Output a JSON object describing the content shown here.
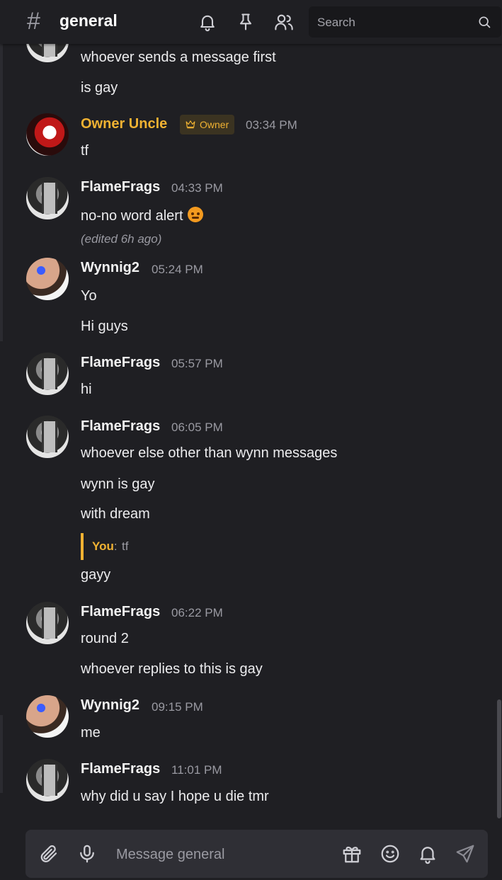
{
  "header": {
    "channel_symbol": "#",
    "channel_name": "general",
    "icons": [
      "bell-icon",
      "pin-icon",
      "members-icon",
      "search-icon"
    ],
    "search_placeholder": "Search"
  },
  "messages": [
    {
      "lines": [
        "whoever sends a message first",
        "is gay"
      ]
    },
    {
      "author": "Owner Uncle",
      "badge": "Owner",
      "time": "03:34 PM",
      "lines": [
        "tf"
      ]
    },
    {
      "author": "FlameFrags",
      "time": "04:33 PM",
      "lines": [
        "no-no word alert"
      ],
      "emoji": "angry-face-emoji",
      "edited": "(edited 6h ago)"
    },
    {
      "author": "Wynnig2",
      "time": "05:24 PM",
      "lines": [
        "Yo",
        "Hi guys"
      ]
    },
    {
      "author": "FlameFrags",
      "time": "05:57 PM",
      "lines": [
        "hi"
      ]
    },
    {
      "author": "FlameFrags",
      "time": "06:05 PM",
      "lines": [
        "whoever else other than wynn messages",
        "wynn is gay",
        "with dream"
      ],
      "reply": {
        "user": "You",
        "sep": ":",
        "text": "tf"
      },
      "after_reply": "gayy"
    },
    {
      "author": "FlameFrags",
      "time": "06:22 PM",
      "lines": [
        "round 2",
        "whoever replies to this is gay"
      ]
    },
    {
      "author": "Wynnig2",
      "time": "09:15 PM",
      "lines": [
        "me"
      ]
    },
    {
      "author": "FlameFrags",
      "time": "11:01 PM",
      "lines": [
        "why did u say I hope u die tmr"
      ]
    }
  ],
  "composer": {
    "placeholder": "Message general",
    "icons": [
      "attach-icon",
      "mic-icon",
      "gift-icon",
      "emoji-icon",
      "bell-icon",
      "send-icon"
    ]
  },
  "colors": {
    "background": "#1f1f23",
    "owner_accent": "#f0b232",
    "muted": "#9a9aa2"
  }
}
